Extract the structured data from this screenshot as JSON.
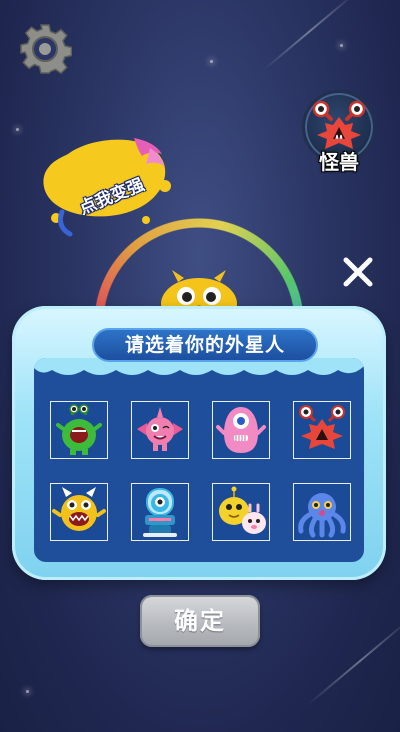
{
  "screen": {
    "upgrade_label": "点我变强",
    "monster_label": "怪兽",
    "dialog_title": "请选着你的外星人",
    "confirm_label": "确定"
  },
  "icons": {
    "settings": "gear-icon",
    "close": "close-icon",
    "monster_avatar": "red-monster-icon"
  },
  "aliens": [
    {
      "name": "green-alien",
      "color": "#3dbb3b"
    },
    {
      "name": "pink-dragon",
      "color": "#f07fb0"
    },
    {
      "name": "pink-blob",
      "color": "#f28ac4"
    },
    {
      "name": "red-monster",
      "color": "#e8463a"
    },
    {
      "name": "yellow-horned",
      "color": "#f2c21b"
    },
    {
      "name": "blue-robot",
      "color": "#39b7e6"
    },
    {
      "name": "yellow-pair",
      "color": "#f4d22c"
    },
    {
      "name": "blue-octopus",
      "color": "#5b86ea"
    }
  ],
  "colors": {
    "background": "#2c3766",
    "dialog_panel": "#1f4f9a",
    "dialog_frame": "#9fe3f8",
    "confirm_button": "#b8bbc0"
  }
}
